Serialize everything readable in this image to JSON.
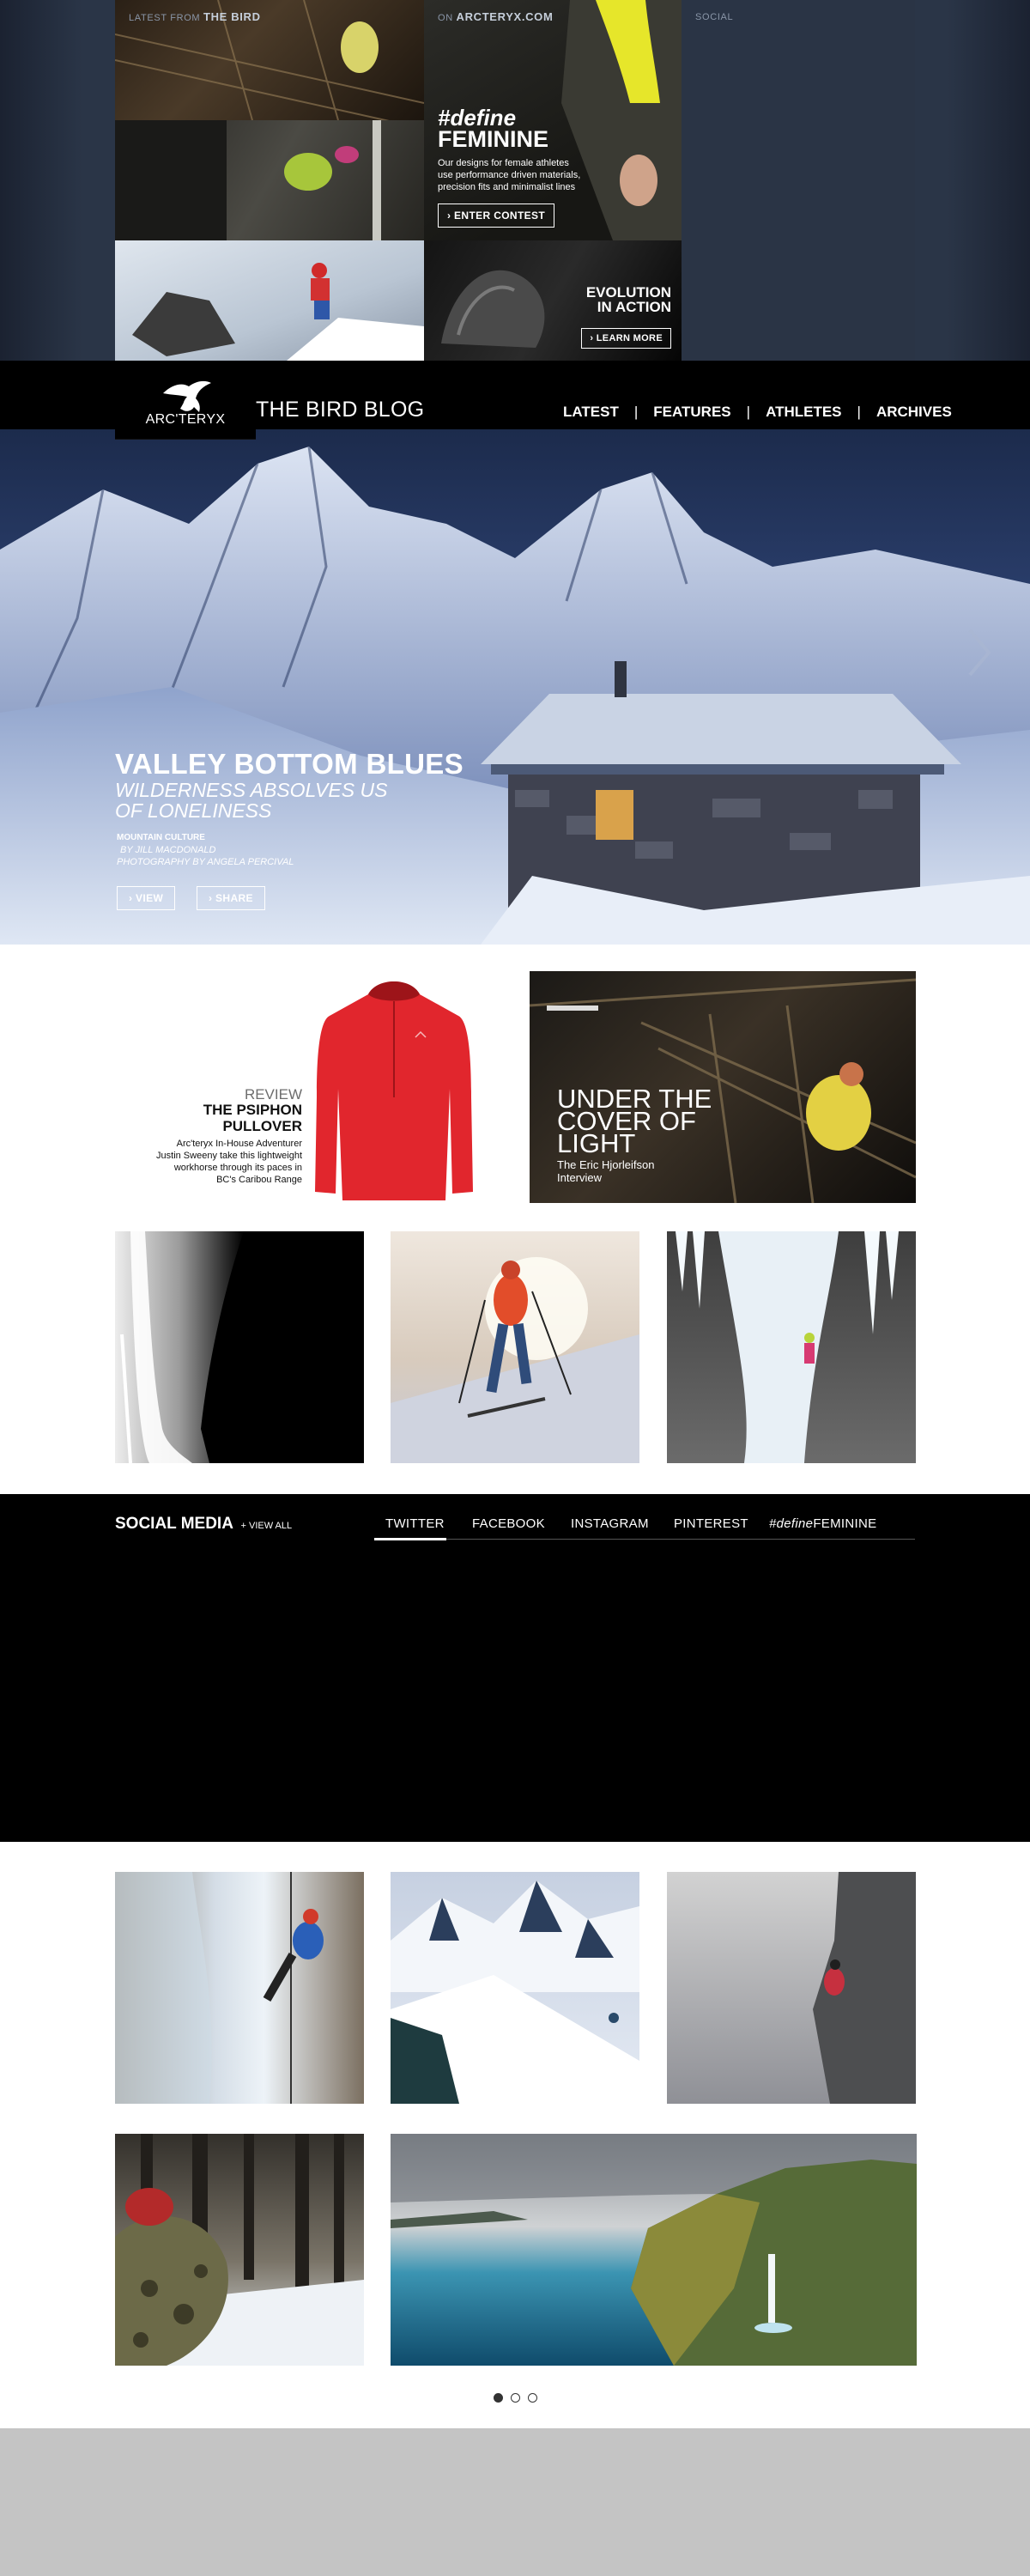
{
  "top": {
    "label_latest_prefix": "LATEST FROM",
    "label_latest_strong": "THE BIRD",
    "label_on_prefix": "ON",
    "label_on_strong": "ARCTERYX.COM",
    "label_social": "SOCIAL",
    "promo": {
      "hashtag": "#define",
      "title": "FEMININE",
      "body_lines": [
        "Our designs for female athletes",
        "use performance driven materials,",
        "precision fits and minimalist lines"
      ],
      "cta": "› ENTER CONTEST"
    },
    "evolution": {
      "title_line1": "EVOLUTION",
      "title_line2": "IN ACTION",
      "cta": "› LEARN MORE"
    }
  },
  "header": {
    "brand": "ARC'TERYX",
    "blog_title": "THE BIRD BLOG",
    "nav": [
      "LATEST",
      "FEATURES",
      "ATHLETES",
      "ARCHIVES"
    ],
    "separator": "|"
  },
  "hero": {
    "title": "VALLEY BOTTOM BLUES",
    "subtitle_line1": "WILDERNESS ABSOLVES US",
    "subtitle_line2": "OF LONELINESS",
    "category": "MOUNTAIN CULTURE",
    "byline": "BY JILL MACDONALD",
    "photo_credit": "PHOTOGRAPHY BY ANGELA PERCIVAL",
    "view_label": "› VIEW",
    "share_label": "› SHARE"
  },
  "review": {
    "kicker": "REVIEW",
    "title_line1": "THE PSIPHON",
    "title_line2": "PULLOVER",
    "body_lines": [
      "Arc'teryx In-House Adventurer",
      "Justin Sweeny take this lightweight",
      "workhorse through its paces in",
      "BC's Caribou Range"
    ]
  },
  "feature": {
    "title_line1": "UNDER THE",
    "title_line2": "COVER OF",
    "title_line3": "LIGHT",
    "sub_line1": "The Eric Hjorleifson",
    "sub_line2": "Interview"
  },
  "social": {
    "heading": "SOCIAL MEDIA",
    "view_all": "+ VIEW ALL",
    "tabs": [
      "TWITTER",
      "FACEBOOK",
      "INSTAGRAM",
      "PINTEREST"
    ],
    "tab_define_prefix": "#define",
    "tab_define_suffix": "FEMININE",
    "active_tab": "TWITTER"
  },
  "pagination": {
    "pages": 3,
    "current": 1
  },
  "colors": {
    "accent_red": "#e1262d",
    "black": "#000000",
    "footer_gray": "#c4c4c4"
  }
}
